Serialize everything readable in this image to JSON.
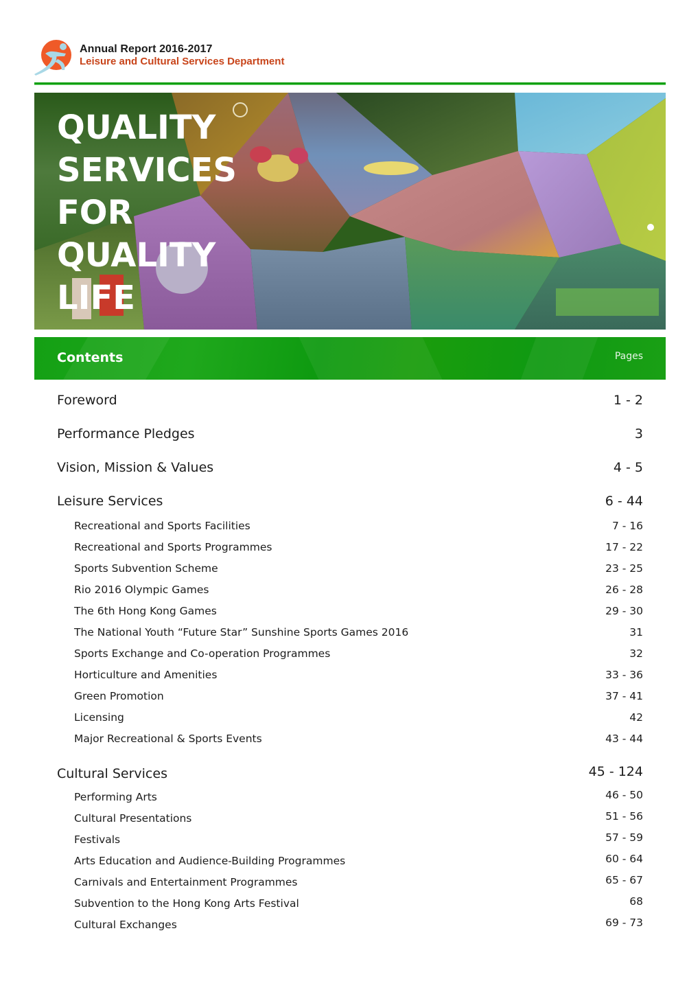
{
  "header": {
    "report_title": "Annual Report 2016-2017",
    "department": "Leisure and Cultural Services Department",
    "logo_icon": "running-figure-logo-icon",
    "accent_color": "#12a012",
    "logo_color": "#ef5a28",
    "department_color": "#c8441a"
  },
  "hero": {
    "title_lines": [
      "QUALITY",
      "SERVICES",
      "FOR",
      "QUALITY",
      "LIFE"
    ],
    "collage_panels": [
      "dance-performance-photo",
      "basketball-game-photo",
      "flower-display-photo",
      "pedal-boats-photo",
      "children-theatre-photo",
      "swimming-children-photo",
      "hockey-match-photo",
      "stormtrooper-exhibition-photo",
      "library-bookshelves-photo",
      "chinese-opera-photo",
      "ball-game-children-photo",
      "cow-sculpture-photo",
      "storytelling-session-photo",
      "fun-run-crowd-photo"
    ]
  },
  "contents": {
    "heading": "Contents",
    "pages_heading": "Pages",
    "bar_color": "#14a014",
    "entries": [
      {
        "label": "Foreword",
        "pages": "1 - 2",
        "level": "main"
      },
      {
        "label": "Performance Pledges",
        "pages": "3",
        "level": "main"
      },
      {
        "label": "Vision, Mission & Values",
        "pages": "4 - 5",
        "level": "main"
      },
      {
        "label": "Leisure Services",
        "pages": "6 - 44",
        "level": "main"
      },
      {
        "label": "Recreational and Sports Facilities",
        "pages": "7 - 16",
        "level": "sub"
      },
      {
        "label": "Recreational and Sports Programmes",
        "pages": "17 - 22",
        "level": "sub"
      },
      {
        "label": "Sports Subvention Scheme",
        "pages": "23 - 25",
        "level": "sub"
      },
      {
        "label": "Rio 2016 Olympic Games",
        "pages": "26 - 28",
        "level": "sub"
      },
      {
        "label": "The 6th Hong Kong Games",
        "pages": "29 - 30",
        "level": "sub"
      },
      {
        "label": "The National Youth “Future Star” Sunshine Sports Games 2016",
        "pages": "31",
        "level": "sub"
      },
      {
        "label": "Sports Exchange and Co-operation Programmes",
        "pages": "32",
        "level": "sub"
      },
      {
        "label": "Horticulture and Amenities",
        "pages": "33 - 36",
        "level": "sub"
      },
      {
        "label": "Green Promotion",
        "pages": "37 - 41",
        "level": "sub"
      },
      {
        "label": "Licensing",
        "pages": "42",
        "level": "sub"
      },
      {
        "label": "Major Recreational & Sports Events",
        "pages": "43 - 44",
        "level": "sub"
      },
      {
        "label": "Cultural Services",
        "pages": "45 - 124",
        "level": "main"
      },
      {
        "label": "Performing Arts",
        "pages": "46 - 50",
        "level": "sub"
      },
      {
        "label": "Cultural Presentations",
        "pages": "51 - 56",
        "level": "sub"
      },
      {
        "label": "Festivals",
        "pages": "57 - 59",
        "level": "sub"
      },
      {
        "label": "Arts Education and Audience-Building Programmes",
        "pages": "60 - 64",
        "level": "sub"
      },
      {
        "label": "Carnivals and Entertainment Programmes",
        "pages": "65 - 67",
        "level": "sub"
      },
      {
        "label": "Subvention to the Hong Kong Arts Festival",
        "pages": "68",
        "level": "sub"
      },
      {
        "label": "Cultural Exchanges",
        "pages": "69 - 73",
        "level": "sub"
      }
    ]
  }
}
